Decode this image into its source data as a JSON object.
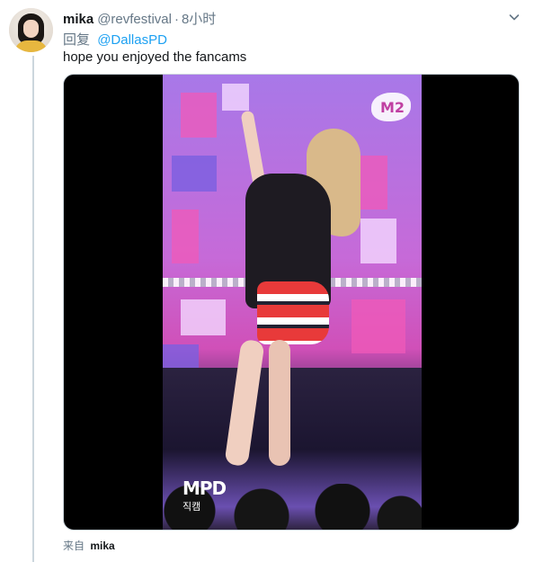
{
  "tweet": {
    "author_name": "mika",
    "author_handle": "@revfestival",
    "separator": "·",
    "time": "8小时",
    "reply_prefix": "回复",
    "reply_target": "@DallasPD",
    "text": "hope you enjoyed the fancams",
    "avatar_icon": "user-avatar",
    "menu_icon": "chevron-down-icon",
    "video": {
      "logo_top_right": "M2",
      "logo_bottom_left_main": "MPD",
      "logo_bottom_left_sub": "직캠"
    }
  },
  "footer": {
    "source_label": "来自",
    "source_name": "mika"
  },
  "colors": {
    "link": "#1da1f2",
    "secondary_text": "#657786",
    "primary_text": "#14171a",
    "thread_line": "#ccd6dd"
  }
}
